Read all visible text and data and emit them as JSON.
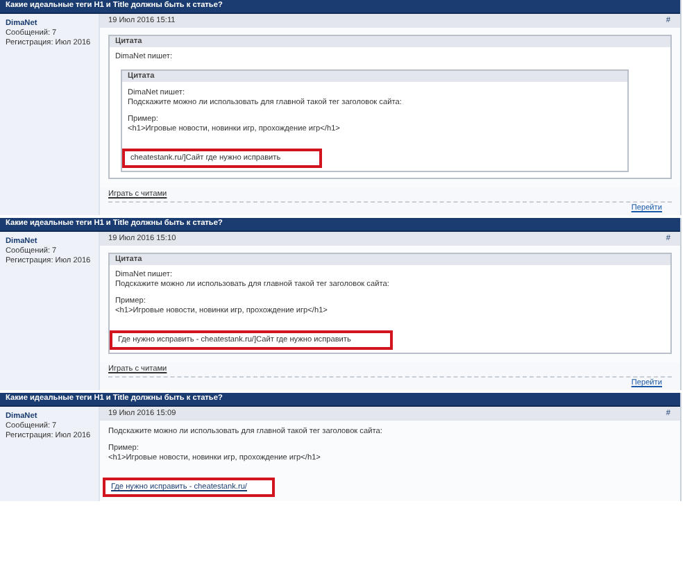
{
  "posts": [
    {
      "title": "Какие идеальные теги H1 и Title должны быть к статье?",
      "author": "DimaNet",
      "messages": "Сообщений: 7",
      "registered": "Регистрация: Июл 2016",
      "date": "19 Июл 2016 15:11",
      "number": "#",
      "body": [
        {
          "kind": "quote",
          "label": "Цитата",
          "body": [
            {
              "kind": "text",
              "lines": [
                "DimaNet пишет:"
              ]
            },
            {
              "kind": "quote",
              "label": "Цитата",
              "body": [
                {
                  "kind": "text",
                  "lines": [
                    "DimaNet пишет:",
                    "Подскажите можно ли использовать для главной такой тег заголовок сайта:"
                  ]
                },
                {
                  "kind": "text",
                  "lines": [
                    "Пример:",
                    "<h1>Игровые новости, новинки игр, прохождение игр</h1>"
                  ]
                },
                {
                  "kind": "marked",
                  "text": "cheatestank.ru/]Сайт где нужно исправить",
                  "underlined": false
                }
              ]
            }
          ]
        }
      ],
      "play_link": "Играть с читами",
      "goto_link": "Перейти"
    },
    {
      "title": "Какие идеальные теги H1 и Title должны быть к статье?",
      "author": "DimaNet",
      "messages": "Сообщений: 7",
      "registered": "Регистрация: Июл 2016",
      "date": "19 Июл 2016 15:10",
      "number": "#",
      "body": [
        {
          "kind": "quote",
          "label": "Цитата",
          "body": [
            {
              "kind": "text",
              "lines": [
                "DimaNet пишет:",
                "Подскажите можно ли использовать для главной такой тег заголовок сайта:"
              ]
            },
            {
              "kind": "text",
              "lines": [
                "Пример:",
                "<h1>Игровые новости, новинки игр, прохождение игр</h1>"
              ]
            },
            {
              "kind": "marked",
              "text": "Где нужно исправить -  cheatestank.ru/]Сайт где нужно исправить",
              "underlined": false
            }
          ]
        }
      ],
      "play_link": "Играть с читами",
      "goto_link": "Перейти"
    },
    {
      "title": "Какие идеальные теги H1 и Title должны быть к статье?",
      "author": "DimaNet",
      "messages": "Сообщений: 7",
      "registered": "Регистрация: Июл 2016",
      "date": "19 Июл 2016 15:09",
      "number": "#",
      "body": [
        {
          "kind": "text",
          "lines": [
            "Подскажите можно ли использовать для главной такой тег заголовок сайта:"
          ]
        },
        {
          "kind": "text",
          "lines": [
            "Пример:",
            "<h1>Игровые новости, новинки игр, прохождение игр</h1>"
          ]
        },
        {
          "kind": "marked",
          "text": "Где нужно исправить - cheatestank.ru/",
          "underlined": true
        }
      ]
    }
  ]
}
